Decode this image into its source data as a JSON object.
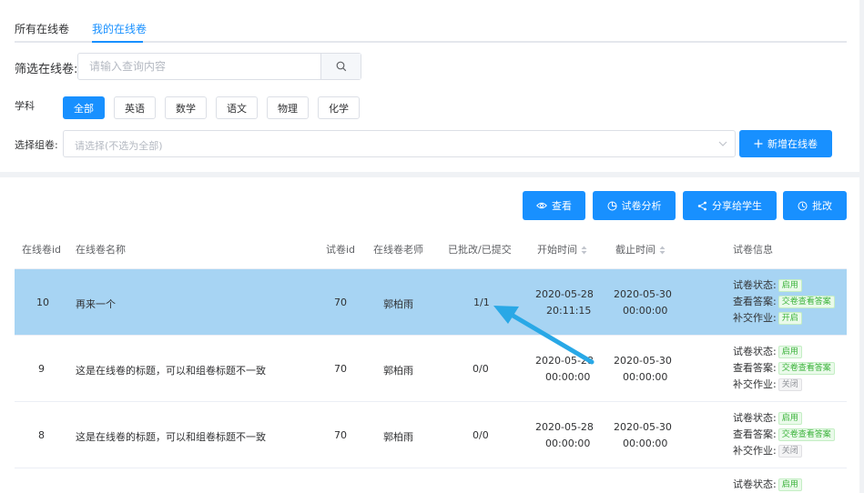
{
  "tabs": [
    {
      "label": "所有在线卷"
    },
    {
      "label": "我的在线卷"
    }
  ],
  "filter": {
    "label": "筛选在线卷:",
    "placeholder": "请输入查询内容",
    "search_icon": "search-icon"
  },
  "subject": {
    "label": "学科",
    "options": [
      "全部",
      "英语",
      "数学",
      "语文",
      "物理",
      "化学"
    ],
    "selected": "全部"
  },
  "group": {
    "label": "选择组卷:",
    "placeholder": "请选择(不选为全部)",
    "add_button": "新增在线卷"
  },
  "actions": {
    "view": "查看",
    "analysis": "试卷分析",
    "share": "分享给学生",
    "grade": "批改"
  },
  "table": {
    "headers": {
      "id": "在线卷id",
      "name": "在线卷名称",
      "paper_id": "试卷id",
      "teacher": "在线卷老师",
      "progress": "已批改/已提交",
      "start": "开始时间",
      "end": "截止时间",
      "info": "试卷信息"
    },
    "info_labels": {
      "status": "试卷状态:",
      "answers": "查看答案:",
      "late": "补交作业:"
    },
    "rows": [
      {
        "id": "10",
        "name": "再来一个",
        "paper_id": "70",
        "teacher": "郭柏雨",
        "progress": "1/1",
        "start_date": "2020-05-28",
        "start_time": "20:11:15",
        "end_date": "2020-05-30",
        "end_time": "00:00:00",
        "status": "启用",
        "answers": "交卷查看答案",
        "late": "开启"
      },
      {
        "id": "9",
        "name": "这是在线卷的标题，可以和组卷标题不一致",
        "paper_id": "70",
        "teacher": "郭柏雨",
        "progress": "0/0",
        "start_date": "2020-05-28",
        "start_time": "00:00:00",
        "end_date": "2020-05-30",
        "end_time": "00:00:00",
        "status": "启用",
        "answers": "交卷查看答案",
        "late": "关闭"
      },
      {
        "id": "8",
        "name": "这是在线卷的标题，可以和组卷标题不一致",
        "paper_id": "70",
        "teacher": "郭柏雨",
        "progress": "0/0",
        "start_date": "2020-05-28",
        "start_time": "00:00:00",
        "end_date": "2020-05-30",
        "end_time": "00:00:00",
        "status": "启用",
        "answers": "交卷查看答案",
        "late": "关闭"
      }
    ],
    "partial_row": {
      "status_label": "试卷状态:",
      "status": "启用"
    }
  },
  "colors": {
    "primary": "#1890ff",
    "highlight_row": "#a7d4f3",
    "arrow": "#29a8e6"
  }
}
